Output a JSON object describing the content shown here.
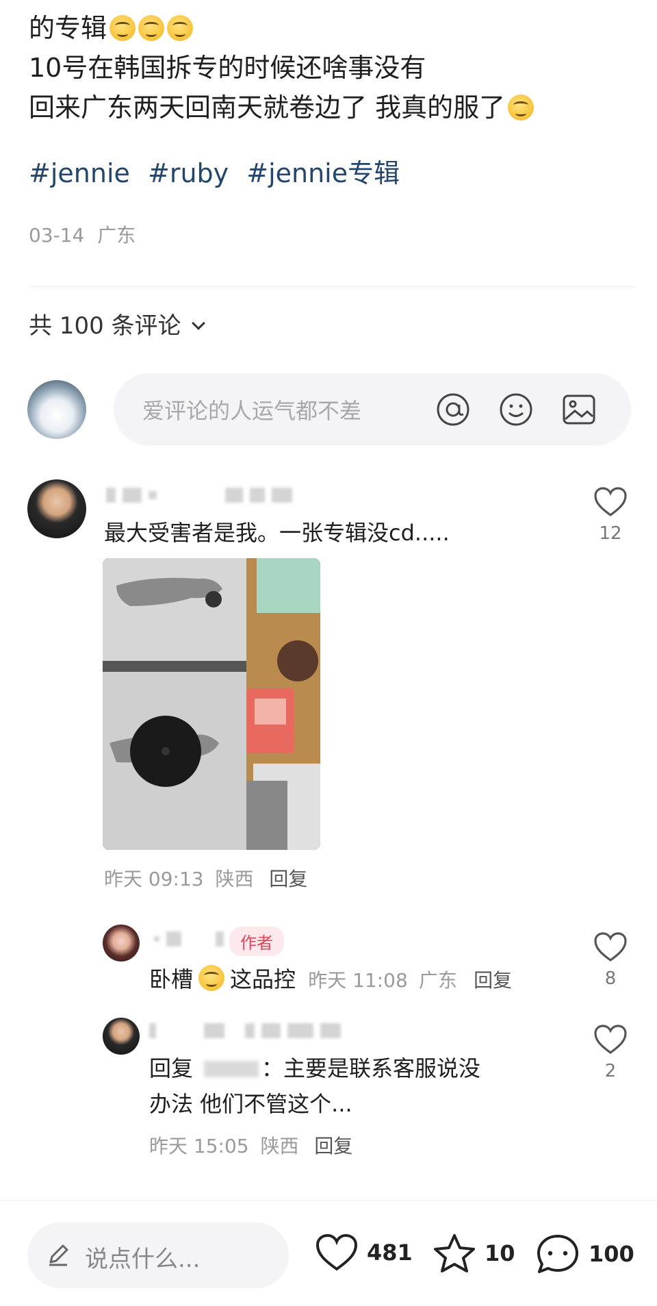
{
  "post": {
    "line1": "的专辑",
    "line2": "10号在韩国拆专的时候还啥事没有",
    "line3": "回来广东两天回南天就卷边了 我真的服了",
    "tags": [
      "#jennie",
      "#ruby",
      "#jennie专辑"
    ],
    "date": "03-14",
    "location": "广东"
  },
  "comments_header": {
    "label": "共 100 条评论"
  },
  "comment_input": {
    "placeholder": "爱评论的人运气都不差"
  },
  "comments": [
    {
      "text": "最大受害者是我。一张专辑没cd.....",
      "time": "昨天 09:13",
      "location": "陕西",
      "reply_label": "回复",
      "likes": "12"
    }
  ],
  "replies": [
    {
      "badge": "作者",
      "text": "卧槽",
      "text2": "这品控",
      "time": "昨天 11:08",
      "location": "广东",
      "reply_label": "回复",
      "likes": "8"
    },
    {
      "prefix": "回复",
      "text_line1": "：主要是联系客服说没",
      "text_line2": "办法 他们不管这个...",
      "time": "昨天 15:05",
      "location": "陕西",
      "reply_label": "回复",
      "likes": "2"
    }
  ],
  "bottom_bar": {
    "say_placeholder": "说点什么...",
    "likes": "481",
    "stars": "10",
    "comments": "100"
  },
  "icons": [
    "smiling-upside-down-emoji",
    "at-icon",
    "smiley-icon",
    "image-icon",
    "heart-icon",
    "star-icon",
    "comment-icon",
    "pencil-icon",
    "laughing-crying-emoji"
  ]
}
